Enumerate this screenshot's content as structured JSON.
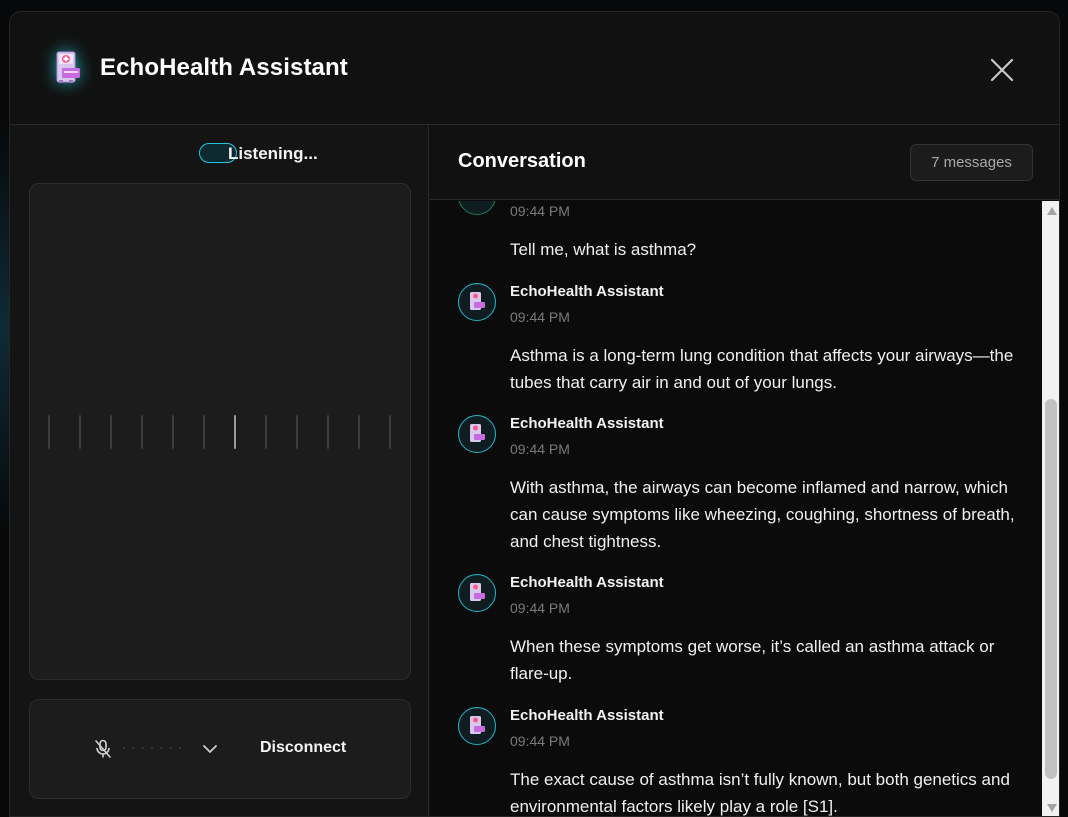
{
  "header": {
    "title": "EchoHealth Assistant",
    "icon": "hospital-kiosk-icon",
    "close_icon": "close-icon"
  },
  "listening": {
    "label": "Listening..."
  },
  "visualizer": {
    "bar_count": 12,
    "active_bar_index": 6
  },
  "controls": {
    "mic_icon": "mic-off-icon",
    "mic_level_text": "· · · · · · ·",
    "dropdown_icon": "chevron-down-icon",
    "disconnect_label": "Disconnect"
  },
  "conversation": {
    "title": "Conversation",
    "count_label": "7 messages",
    "messages": [
      {
        "sender": "",
        "time": "09:44 PM",
        "text": "Tell me, what is asthma?"
      },
      {
        "sender": "EchoHealth Assistant",
        "time": "09:44 PM",
        "text": "Asthma is a long-term lung condition that affects your airways—the tubes that carry air in and out of your lungs."
      },
      {
        "sender": "EchoHealth Assistant",
        "time": "09:44 PM",
        "text": "With asthma, the airways can become inflamed and narrow, which can cause symptoms like wheezing, coughing, shortness of breath, and chest tightness."
      },
      {
        "sender": "EchoHealth Assistant",
        "time": "09:44 PM",
        "text": "When these symptoms get worse, it’s called an asthma attack or flare-up."
      },
      {
        "sender": "EchoHealth Assistant",
        "time": "09:44 PM",
        "text": "The exact cause of asthma isn’t fully known, but both genetics and environmental factors likely play a role [S1]."
      }
    ]
  },
  "colors": {
    "accent": "#22c6dc",
    "background": "#111111",
    "panel": "#1c1c1c"
  }
}
